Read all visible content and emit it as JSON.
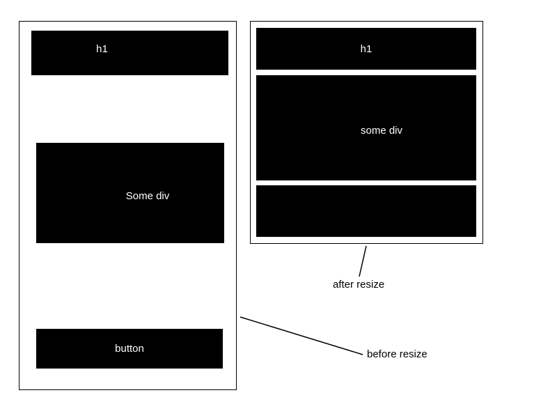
{
  "left": {
    "h1_label": "h1",
    "div_label": "Some div",
    "button_label": "button"
  },
  "right": {
    "h1_label": "h1",
    "div_label": "some div",
    "button_label": ""
  },
  "labels": {
    "after": "after resize",
    "before": "before resize"
  }
}
